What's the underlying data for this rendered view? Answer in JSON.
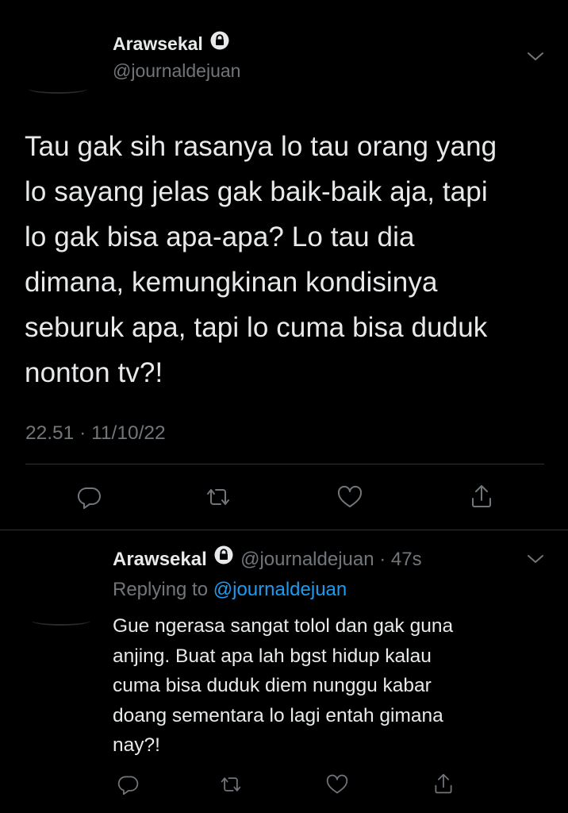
{
  "main_tweet": {
    "display_name": "Arawsekal",
    "handle": "@journaldejuan",
    "text_lines": [
      "Tau gak sih rasanya lo tau orang yang",
      "lo sayang jelas gak baik-baik aja, tapi",
      "lo gak bisa apa-apa? Lo tau dia",
      "dimana, kemungkinan kondisinya",
      "seburuk apa, tapi lo cuma bisa duduk",
      "nonton tv?!"
    ],
    "timestamp": "22.51 · 11/10/22"
  },
  "reply": {
    "display_name": "Arawsekal",
    "handle": "@journaldejuan",
    "time": "· 47s",
    "replying_label": "Replying to",
    "replying_handle": "@journaldejuan",
    "text_lines": [
      "Gue ngerasa sangat tolol dan gak guna",
      "anjing. Buat apa lah bgst hidup kalau",
      "cuma bisa duduk diem nunggu kabar",
      "doang sementara lo lagi entah gimana",
      "nay?!"
    ]
  },
  "icons": {
    "lock": "lock-icon",
    "more": "chevron-down-icon",
    "reply": "reply-icon",
    "retweet": "retweet-icon",
    "like": "heart-icon",
    "share": "share-icon"
  },
  "colors": {
    "background": "#000000",
    "text": "#e7e9ea",
    "muted": "#71767b",
    "link": "#1d9bf0",
    "divider": "#2f3336"
  }
}
